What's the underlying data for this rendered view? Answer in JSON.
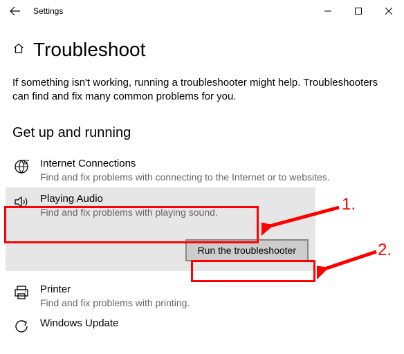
{
  "titlebar": {
    "title": "Settings"
  },
  "header": {
    "page_title": "Troubleshoot"
  },
  "intro": "If something isn't working, running a troubleshooter might help. Troubleshooters can find and fix many common problems for you.",
  "section": {
    "title": "Get up and running"
  },
  "items": {
    "internet": {
      "title": "Internet Connections",
      "desc": "Find and fix problems with connecting to the Internet or to websites."
    },
    "audio": {
      "title": "Playing Audio",
      "desc": "Find and fix problems with playing sound.",
      "run_label": "Run the troubleshooter"
    },
    "printer": {
      "title": "Printer",
      "desc": "Find and fix problems with printing."
    },
    "update": {
      "title": "Windows Update"
    }
  },
  "annotations": {
    "label1": "1.",
    "label2": "2."
  }
}
